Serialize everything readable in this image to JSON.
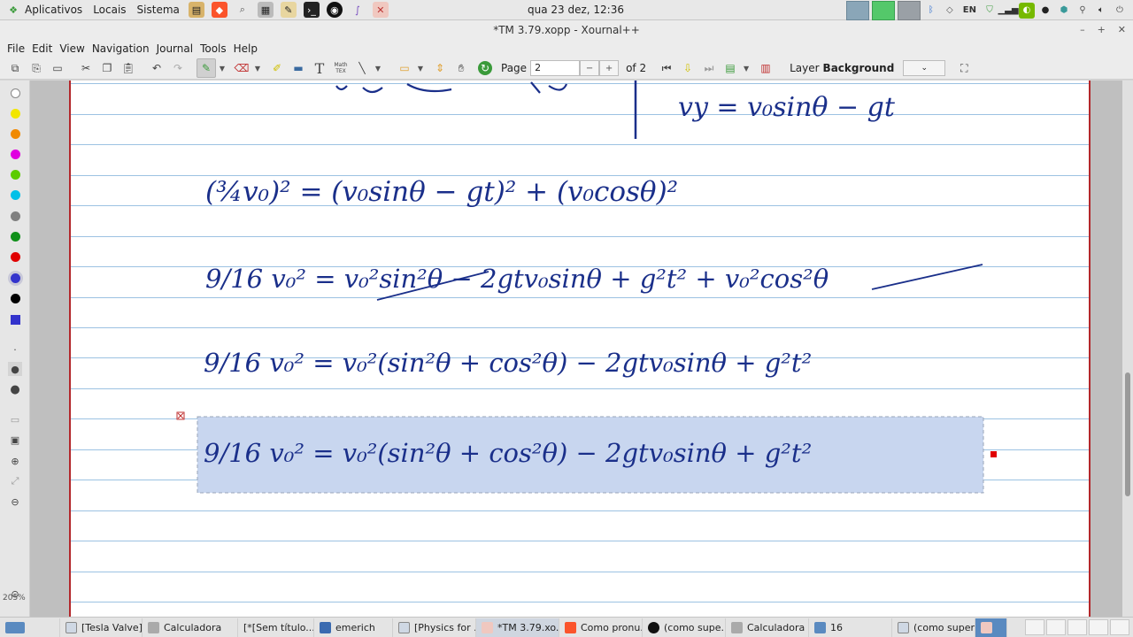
{
  "system_panel": {
    "apps_label": "Aplicativos",
    "places_label": "Locais",
    "system_label": "Sistema",
    "clock": "qua 23 dez, 12:36",
    "keyboard_layout": "EN"
  },
  "window": {
    "title": "*TM 3.79.xopp - Xournal++"
  },
  "menu": {
    "items": [
      "File",
      "Edit",
      "View",
      "Navigation",
      "Journal",
      "Tools",
      "Help"
    ]
  },
  "toolbar": {
    "page_label": "Page",
    "page_value": "2",
    "page_of": "of 2",
    "layer_label": "Layer",
    "layer_value": "Background",
    "text_tool_glyph": "T",
    "math_tool_label": "Math TEX"
  },
  "palette": {
    "zoom_label": "205%",
    "colors": [
      "#ffffff",
      "#ffff00",
      "#ff8000",
      "#ff00ff",
      "#66cc00",
      "#00c0ff",
      "#808080",
      "#008000",
      "#ff0000",
      "#3333cc",
      "#000000",
      "#3333cc"
    ]
  },
  "taskbar": {
    "tasks": [
      "[Tesla Valve]",
      "Calculadora",
      "[*[Sem título...",
      "emerich",
      "[Physics for ...",
      "*TM 3.79.xo...",
      "Como pronu...",
      "(como supe...",
      "Calculadora",
      "16",
      "(como super..."
    ]
  },
  "content": {
    "line0_right": "vy = v₀sinθ − gt",
    "line1": "(¾v₀)² = (v₀sinθ − gt)² + (v₀cosθ)²",
    "line2": "9/16 v₀² = v₀²sin²θ − 2gtv₀sinθ + g²t² + v₀²cos²θ",
    "line3": "9/16 v₀² = v₀²(sin²θ + cos²θ) − 2gtv₀sinθ + g²t²",
    "line4_selected": "9/16 v₀² = v₀²(sin²θ + cos²θ) − 2gtv₀sinθ + g²t²"
  }
}
